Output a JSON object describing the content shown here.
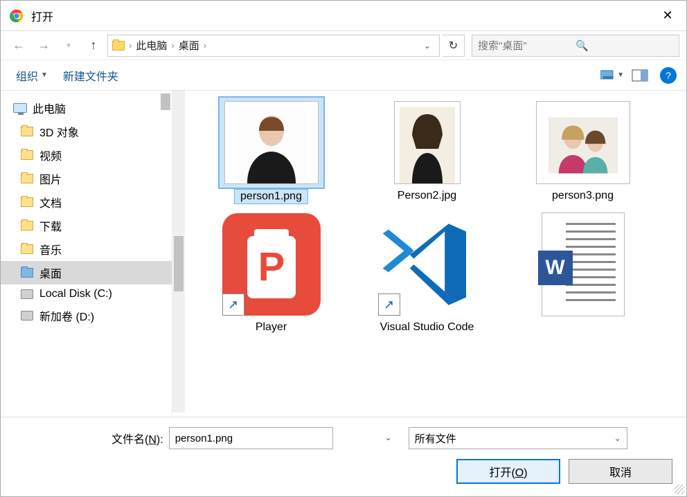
{
  "title": "打开",
  "nav": {
    "crumb1": "此电脑",
    "crumb2": "桌面",
    "search_placeholder": "搜索\"桌面\""
  },
  "toolbar": {
    "organize": "组织",
    "new_folder": "新建文件夹"
  },
  "tree": {
    "this_pc": "此电脑",
    "objects3d": "3D 对象",
    "videos": "视频",
    "pictures": "图片",
    "documents": "文档",
    "downloads": "下载",
    "music": "音乐",
    "desktop": "桌面",
    "local_disk": "Local Disk (C:)",
    "new_volume": "新加卷 (D:)"
  },
  "files": {
    "f1": "person1.png",
    "f2": "Person2.jpg",
    "f3": "person3.png",
    "f4": "Player",
    "f5": "Visual Studio Code"
  },
  "footer": {
    "filename_label_pre": "文件名(",
    "filename_label_u": "N",
    "filename_label_post": "):",
    "filename_value": "person1.png",
    "filter": "所有文件",
    "open_pre": "打开(",
    "open_u": "O",
    "open_post": ")",
    "cancel": "取消"
  }
}
